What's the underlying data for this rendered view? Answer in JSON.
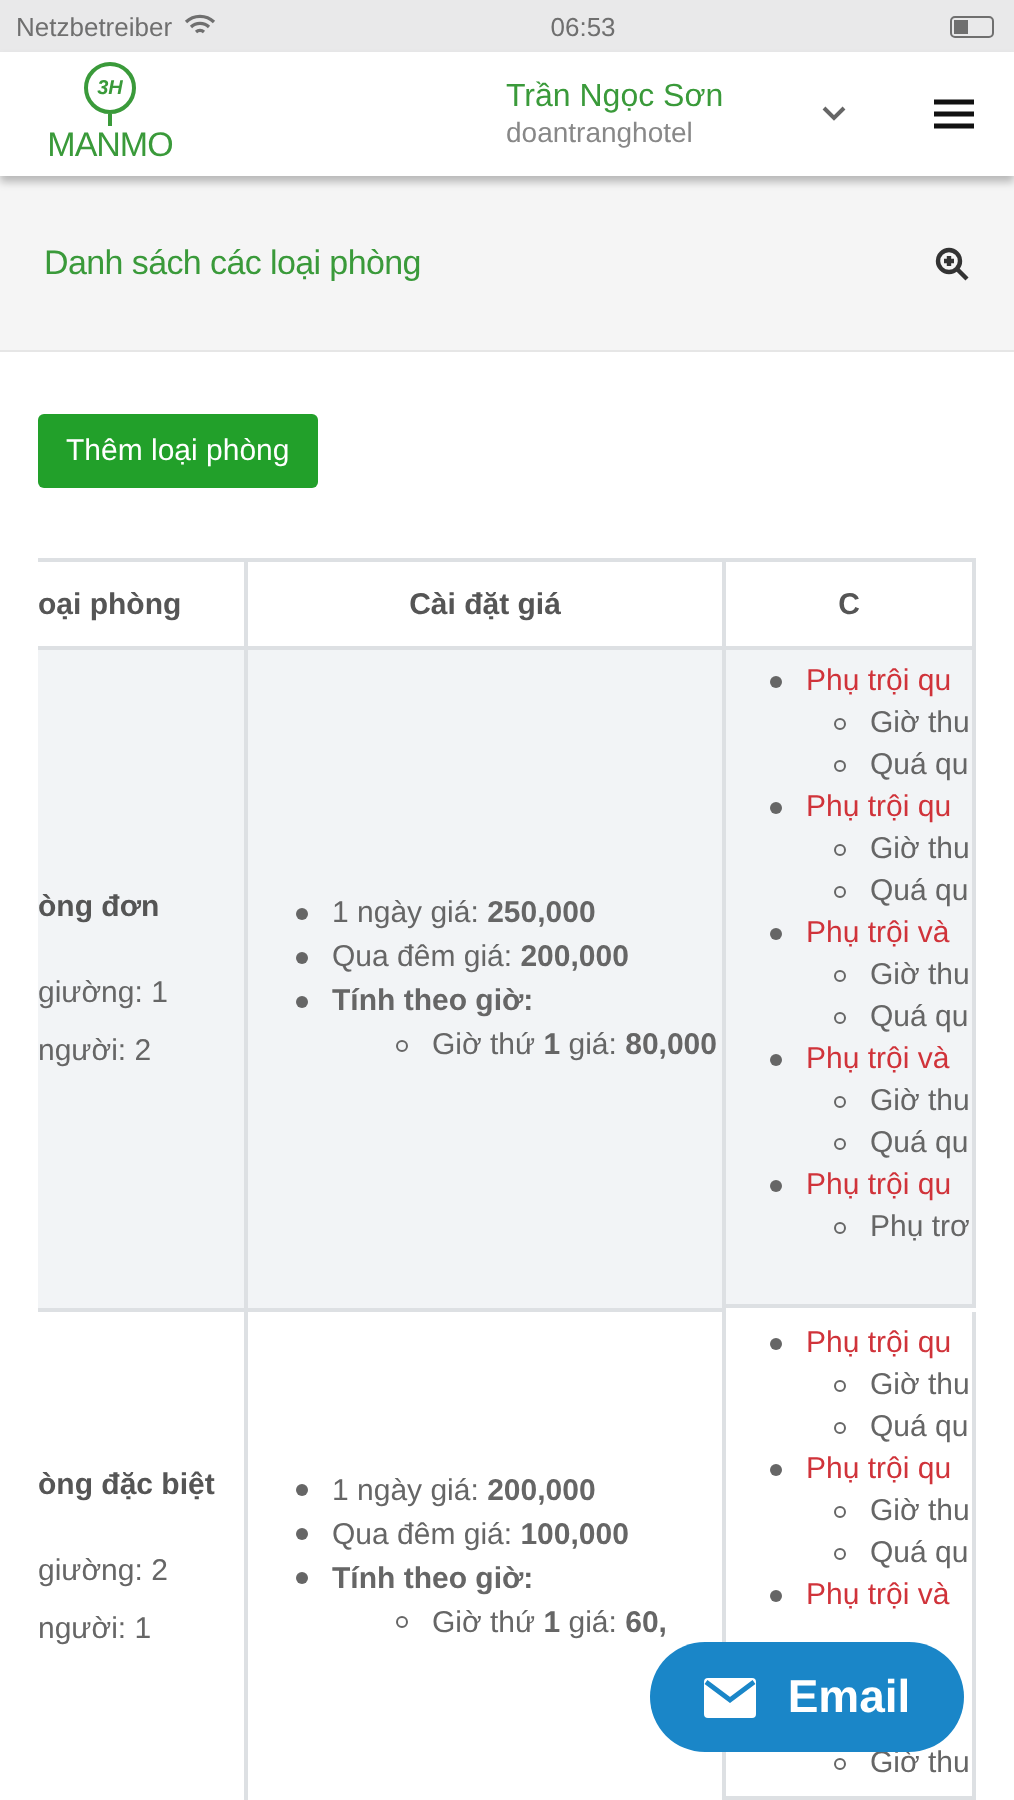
{
  "status_bar": {
    "carrier": "Netzbetreiber",
    "time": "06:53"
  },
  "header": {
    "logo_badge": "3H",
    "logo_text": "MANMO",
    "user_name": "Trần Ngọc Sơn",
    "hotel": "doantranghotel"
  },
  "section": {
    "title": "Danh sách các loại phòng"
  },
  "add_button": "Thêm loại phòng",
  "table": {
    "columns": [
      "oại phòng",
      "Cài đặt giá",
      "C"
    ],
    "rows": [
      {
        "striped": true,
        "name": "òng đơn",
        "details": [
          "giường: 1",
          "người: 2"
        ],
        "prices": [
          {
            "kind": "item",
            "text": "1 ngày giá: **250,000**"
          },
          {
            "kind": "item",
            "text": "Qua đêm giá: **200,000**"
          },
          {
            "kind": "heading",
            "text": "Tính theo giờ:"
          },
          {
            "kind": "sub",
            "text": "Giờ thứ **1** giá: **80,000**"
          }
        ],
        "surcharges": [
          {
            "kind": "main",
            "text": "Phụ trội qu"
          },
          {
            "kind": "sub",
            "text": "Giờ thu"
          },
          {
            "kind": "sub",
            "text": "Quá qu"
          },
          {
            "kind": "main",
            "text": "Phụ trội qu"
          },
          {
            "kind": "sub",
            "text": "Giờ thu"
          },
          {
            "kind": "sub",
            "text": "Quá qu"
          },
          {
            "kind": "main",
            "text": "Phụ trội và"
          },
          {
            "kind": "sub",
            "text": "Giờ thu"
          },
          {
            "kind": "sub",
            "text": "Quá qu"
          },
          {
            "kind": "main",
            "text": "Phụ trội và"
          },
          {
            "kind": "sub",
            "text": "Giờ thu"
          },
          {
            "kind": "sub",
            "text": "Quá qu"
          },
          {
            "kind": "main",
            "text": "Phụ trội qu"
          },
          {
            "kind": "sub",
            "text": "Phụ trơ"
          }
        ]
      },
      {
        "striped": false,
        "name": "òng đặc biệt",
        "details": [
          "giường: 2",
          "người: 1"
        ],
        "prices": [
          {
            "kind": "item",
            "text": "1 ngày giá: **200,000**"
          },
          {
            "kind": "item",
            "text": "Qua đêm giá: **100,000**"
          },
          {
            "kind": "heading",
            "text": "Tính theo giờ:"
          },
          {
            "kind": "sub",
            "text": "Giờ thứ **1** giá: **60,**"
          }
        ],
        "surcharges": [
          {
            "kind": "main",
            "text": "Phụ trội qu"
          },
          {
            "kind": "sub",
            "text": "Giờ thu"
          },
          {
            "kind": "sub",
            "text": "Quá qu"
          },
          {
            "kind": "main",
            "text": "Phụ trội qu"
          },
          {
            "kind": "sub",
            "text": "Giờ thu"
          },
          {
            "kind": "sub",
            "text": "Quá qu"
          },
          {
            "kind": "main",
            "text": "Phụ trội và"
          },
          {
            "kind": "spacer"
          },
          {
            "kind": "spacer"
          },
          {
            "kind": "spacer"
          },
          {
            "kind": "sub",
            "text": "Giờ thu"
          }
        ]
      }
    ]
  },
  "email_button": "Email"
}
